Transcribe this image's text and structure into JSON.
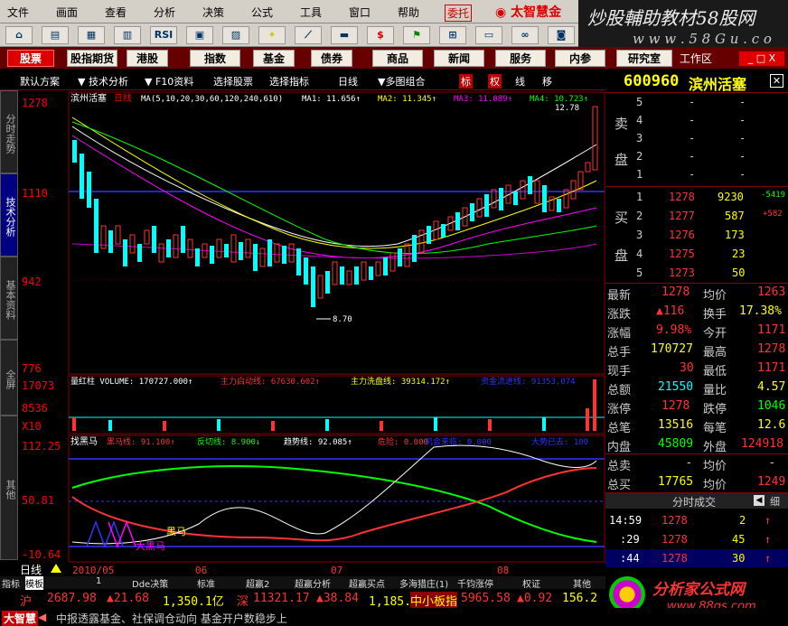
{
  "menu": {
    "items": [
      "文件",
      "画面",
      "查看",
      "分析",
      "决策",
      "公式",
      "工具",
      "窗口",
      "帮助"
    ],
    "brand_small": "委托",
    "brand": "太智慧金"
  },
  "watermark": {
    "title": "炒股輔助教材58股网",
    "url": "w w w . 5 8 G u . c o m"
  },
  "toolbar": {
    "icons": [
      "home-icon",
      "dollar-icon",
      "grid-icon",
      "rsi-icon",
      "table-icon",
      "star-icon",
      "ruler-icon",
      "bar-icon",
      "s-icon",
      "flag-icon",
      "abacus-icon",
      "box-icon",
      "binoculars-icon",
      "camera-icon",
      "pen-icon"
    ],
    "rsi_label": "RSI",
    "s_label": "$"
  },
  "nav": {
    "buttons": [
      "股票",
      "股指期货",
      "港股",
      "指数",
      "基金",
      "债券",
      "商品",
      "新闻",
      "服务",
      "内参",
      "研究室"
    ],
    "workspace": "工作区",
    "window_controls": [
      "_",
      "□",
      "X"
    ]
  },
  "tabs": {
    "default_scheme": "默认方案",
    "items": [
      "技术分析",
      "F10资料",
      "选择股票",
      "选择指标",
      "日线",
      "多图组合",
      "标",
      "权",
      "线",
      "移"
    ]
  },
  "vtabs": [
    "分时走势",
    "技术分析",
    "基本资料",
    "全屏",
    "其他"
  ],
  "stock": {
    "code": "600960",
    "name": "滨州活塞",
    "period": "日线"
  },
  "main_chart": {
    "ma_header": "MA(5,10,20,30,60,120,240,610)",
    "ma1": "MA1: 11.656↑",
    "ma2": "MA2: 11.345↑",
    "ma3": "MA3: 11.089↑",
    "ma4": "MA4: 10.723↑",
    "y_labels": [
      "1278",
      "1110",
      "942",
      "776"
    ],
    "high_label": "12.78",
    "low_label": "8.70",
    "volume_header": "量红柱 VOLUME: 170727.000↑",
    "volume_main_start": "主力启动线: 67630.602↑",
    "volume_main_wash": "主力洗盘线: 39314.172↑",
    "volume_extra": "资金流进线: 91353.074",
    "vol_labels": [
      "17073",
      "8536",
      "X10"
    ],
    "ind_header": "找黑马",
    "ind_black_horse": "黑马线: 91.100↑",
    "ind_rebound": "反切线: 8.900↓",
    "ind_trend": "趋势线: 92.085↑",
    "ind_danger": "危险: 0.000",
    "ind_chance": "机会来临: 0.000",
    "ind_trend_end": "大势已去: 100",
    "ind_y": [
      "112.25",
      "50.81",
      "-10.64"
    ],
    "ind_annot_black": "黑马",
    "ind_annot_big": "大黑马",
    "x_labels": [
      "2010/05",
      "06",
      "07",
      "08"
    ],
    "period_label": "日线"
  },
  "orderbook": {
    "sell_label": "卖",
    "sell_label2": "盘",
    "buy_label": "买",
    "buy_label2": "盘",
    "asks": [
      {
        "lvl": "5",
        "price": "-",
        "vol": "-",
        "chg": ""
      },
      {
        "lvl": "4",
        "price": "-",
        "vol": "-",
        "chg": ""
      },
      {
        "lvl": "3",
        "price": "-",
        "vol": "-",
        "chg": ""
      },
      {
        "lvl": "2",
        "price": "-",
        "vol": "-",
        "chg": ""
      },
      {
        "lvl": "1",
        "price": "-",
        "vol": "-",
        "chg": ""
      }
    ],
    "bids": [
      {
        "lvl": "1",
        "price": "1278",
        "vol": "9230",
        "chg": "-5419"
      },
      {
        "lvl": "2",
        "price": "1277",
        "vol": "587",
        "chg": "+582"
      },
      {
        "lvl": "3",
        "price": "1276",
        "vol": "173",
        "chg": ""
      },
      {
        "lvl": "4",
        "price": "1275",
        "vol": "23",
        "chg": ""
      },
      {
        "lvl": "5",
        "price": "1273",
        "vol": "50",
        "chg": ""
      }
    ]
  },
  "stats": [
    {
      "k1": "最新",
      "v1": "1278",
      "k2": "均价",
      "v2": "1263"
    },
    {
      "k1": "涨跌",
      "v1": "▲116",
      "k2": "换手",
      "v2": "17.38%"
    },
    {
      "k1": "涨幅",
      "v1": "9.98%",
      "k2": "今开",
      "v2": "1171"
    },
    {
      "k1": "总手",
      "v1": "170727",
      "k2": "最高",
      "v2": "1278"
    },
    {
      "k1": "现手",
      "v1": "30",
      "k2": "最低",
      "v2": "1171"
    },
    {
      "k1": "总额",
      "v1": "21550",
      "k2": "量比",
      "v2": "4.57"
    },
    {
      "k1": "涨停",
      "v1": "1278",
      "k2": "跌停",
      "v2": "1046"
    },
    {
      "k1": "总笔",
      "v1": "13516",
      "k2": "每笔",
      "v2": "12.6"
    },
    {
      "k1": "内盘",
      "v1": "45809",
      "k2": "外盘",
      "v2": "124918"
    },
    {
      "k1": "总卖",
      "v1": "-",
      "k2": "均价",
      "v2": "-"
    },
    {
      "k1": "总买",
      "v1": "17765",
      "k2": "均价",
      "v2": "1249"
    }
  ],
  "ticks": {
    "title": "分时成交",
    "rows": [
      {
        "time": "14:59",
        "price": "1278",
        "vol": "2",
        "dir": "↑"
      },
      {
        "time": ":29",
        "price": "1278",
        "vol": "45",
        "dir": "↑"
      },
      {
        "time": ":44",
        "price": "1278",
        "vol": "30",
        "dir": "↑"
      }
    ]
  },
  "bottom_tabs": [
    "指标",
    "模板",
    "1",
    "Dde决策",
    "标准",
    "超赢2",
    "超赢分析",
    "超赢买点",
    "多海猎庄(1)",
    "千钧涨停",
    "权证",
    "其他"
  ],
  "ticker": {
    "sh_label": "沪",
    "sh_val": "2687.98",
    "sh_chg": "▲21.68",
    "sh_amt": "1,350.1亿",
    "sz_label": "深",
    "sz_val": "11321.17",
    "sz_chg": "▲38.84",
    "sz_amt": "1,185.4亿",
    "sme_label": "中小板指",
    "sme_val": "5965.58",
    "sme_chg": "▲0.92",
    "sme_amt": "156.2亿"
  },
  "news": {
    "brand": "大智慧",
    "headline": "中报透露基金、社保调仓动向 基金开户数稳步上"
  },
  "bottom_brand": {
    "name": "分析家公式网",
    "url": "www.88gs.com"
  },
  "colors": {
    "bg": "#000000",
    "up": "#ff3333",
    "down": "#00ffff",
    "frame": "#880000"
  }
}
